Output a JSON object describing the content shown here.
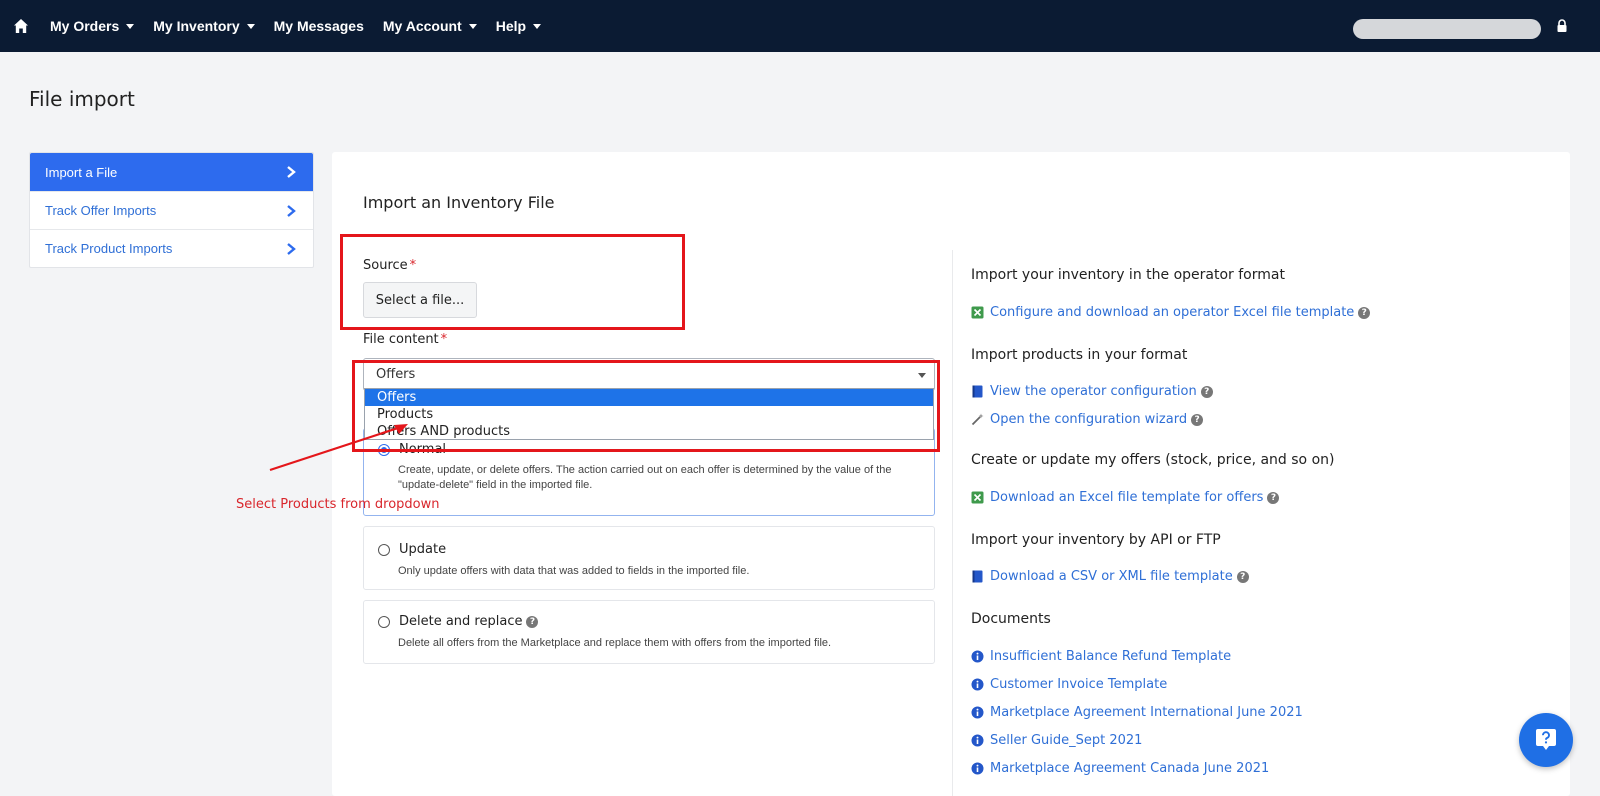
{
  "nav": {
    "items": [
      {
        "label": "My Orders",
        "caret": true
      },
      {
        "label": "My Inventory",
        "caret": true
      },
      {
        "label": "My Messages",
        "caret": false
      },
      {
        "label": "My Account",
        "caret": true
      },
      {
        "label": "Help",
        "caret": true
      }
    ]
  },
  "page": {
    "title": "File import"
  },
  "sidebar": {
    "items": [
      {
        "label": "Import a File",
        "active": true
      },
      {
        "label": "Track Offer Imports",
        "active": false
      },
      {
        "label": "Track Product Imports",
        "active": false
      }
    ]
  },
  "form": {
    "title": "Import an Inventory File",
    "source_label": "Source",
    "required_mark": "*",
    "select_file_label": "Select a file...",
    "file_content_label": "File content",
    "file_content_value": "Offers",
    "dropdown_options": [
      "Offers",
      "Products",
      "Offers AND products"
    ],
    "modes": [
      {
        "label": "Normal",
        "desc": "Create, update, or delete offers. The action carried out on each offer is determined by the value of the \"update-delete\" field in the imported file.",
        "checked": true
      },
      {
        "label": "Update",
        "desc": "Only update offers with data that was added to fields in the imported file.",
        "checked": false
      },
      {
        "label": "Delete and replace",
        "desc": "Delete all offers from the Marketplace and replace them with offers from the imported file.",
        "checked": false
      }
    ]
  },
  "right": {
    "sections": [
      {
        "heading": "Import your inventory in the operator format",
        "links": [
          {
            "label": "Configure and download an operator Excel file template",
            "icon": "excel-icon",
            "help": true
          }
        ]
      },
      {
        "heading": "Import products in your format",
        "links": [
          {
            "label": "View the operator configuration",
            "icon": "book-icon",
            "help": true
          },
          {
            "label": "Open the configuration wizard",
            "icon": "wand-icon",
            "help": true
          }
        ]
      },
      {
        "heading": "Create or update my offers (stock, price, and so on)",
        "links": [
          {
            "label": "Download an Excel file template for offers",
            "icon": "excel-icon",
            "help": true
          }
        ]
      },
      {
        "heading": "Import your inventory by API or FTP",
        "links": [
          {
            "label": "Download a CSV or XML file template",
            "icon": "book-icon",
            "help": true
          }
        ]
      },
      {
        "heading": "Documents",
        "links": [
          {
            "label": "Insufficient Balance Refund Template",
            "icon": "info-icon",
            "help": false
          },
          {
            "label": "Customer Invoice Template",
            "icon": "info-icon",
            "help": false
          },
          {
            "label": "Marketplace Agreement International June 2021",
            "icon": "info-icon",
            "help": false
          },
          {
            "label": "Seller Guide_Sept 2021",
            "icon": "info-icon",
            "help": false
          },
          {
            "label": "Marketplace Agreement Canada June 2021",
            "icon": "info-icon",
            "help": false
          }
        ]
      }
    ]
  },
  "annotation": {
    "text": "Select Products from dropdown"
  },
  "help_q": "?",
  "colors": {
    "nav_bg": "#0b1b33",
    "accent": "#2d6bee",
    "link": "#2f6fd6",
    "annotation": "#e4161b"
  }
}
